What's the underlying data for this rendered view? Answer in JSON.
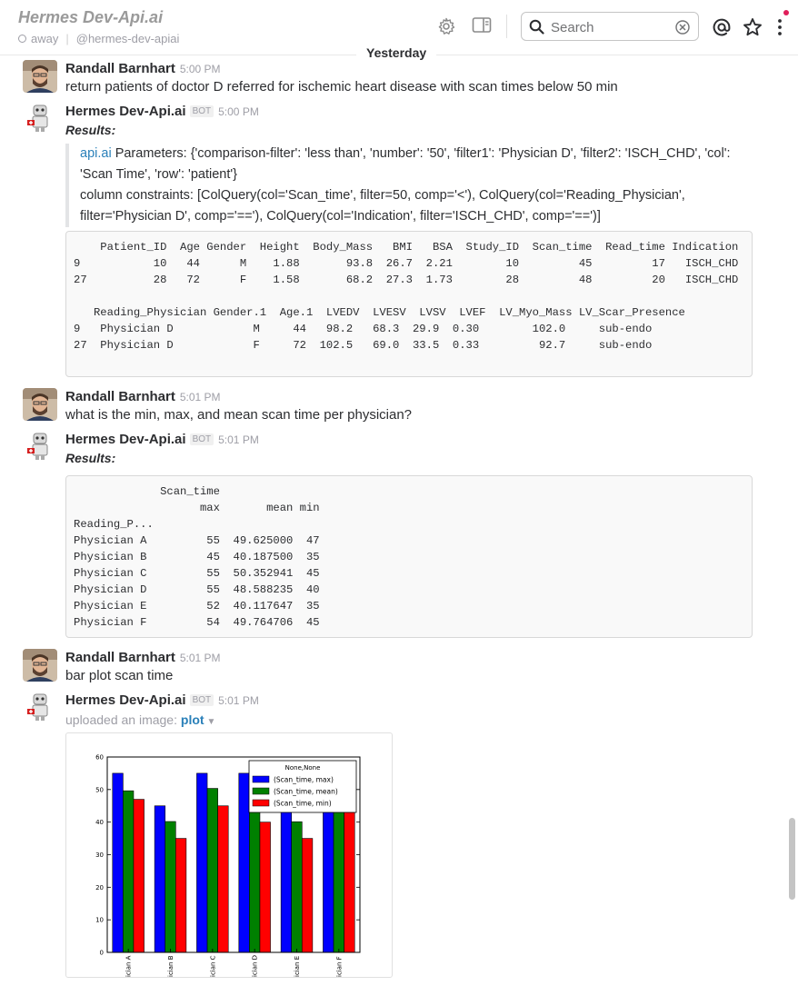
{
  "header": {
    "title": "Hermes Dev-Api.ai",
    "status": "away",
    "handle": "@hermes-dev-apiai",
    "search_placeholder": "Search",
    "notification_color": "#e01e5a"
  },
  "divider": {
    "label": "Yesterday"
  },
  "messages": [
    {
      "author": "Randall Barnhart",
      "time": "5:00 PM",
      "text": "return patients of doctor D referred for ischemic heart disease with scan times below 50 min"
    },
    {
      "author": "Hermes Dev-Api.ai",
      "badge": "BOT",
      "time": "5:00 PM",
      "results_label": "Results:",
      "quote_link": "api.ai",
      "quote_line1": " Parameters: {'comparison-filter': 'less than', 'number': '50', 'filter1': 'Physician D', 'filter2': 'ISCH_CHD', 'col':",
      "quote_line2": "'Scan Time', 'row': 'patient'}",
      "quote_line3": "column constraints: [ColQuery(col='Scan_time', filter=50, comp='<'), ColQuery(col='Reading_Physician',",
      "quote_line4": "filter='Physician D', comp='=='), ColQuery(col='Indication', filter='ISCH_CHD', comp='==')]",
      "code": "    Patient_ID  Age Gender  Height  Body_Mass   BMI   BSA  Study_ID  Scan_time  Read_time Indication  \\\n9           10   44      M    1.88       93.8  26.7  2.21        10         45         17   ISCH_CHD\n27          28   72      F    1.58       68.2  27.3  1.73        28         48         20   ISCH_CHD\n\n   Reading_Physician Gender.1  Age.1  LVEDV  LVESV  LVSV  LVEF  LV_Myo_Mass LV_Scar_Presence\n9   Physician D            M     44   98.2   68.3  29.9  0.30        102.0     sub-endo\n27  Physician D            F     72  102.5   69.0  33.5  0.33         92.7     sub-endo"
    },
    {
      "author": "Randall Barnhart",
      "time": "5:01 PM",
      "text": "what is the min, max, and mean scan time per physician?"
    },
    {
      "author": "Hermes Dev-Api.ai",
      "badge": "BOT",
      "time": "5:01 PM",
      "results_label": "Results:",
      "code": "             Scan_time\n                   max       mean min\nReading_P...\nPhysician A         55  49.625000  47\nPhysician B         45  40.187500  35\nPhysician C         55  50.352941  45\nPhysician D         55  48.588235  40\nPhysician E         52  40.117647  35\nPhysician F         54  49.764706  45"
    },
    {
      "author": "Randall Barnhart",
      "time": "5:01 PM",
      "text": "bar plot scan time"
    },
    {
      "author": "Hermes Dev-Api.ai",
      "badge": "BOT",
      "time": "5:01 PM",
      "uploaded_label": "uploaded an image:",
      "attachment_name": "plot"
    }
  ],
  "chart_data": {
    "type": "bar",
    "categories": [
      "Physician A",
      "Physician B",
      "Physician C",
      "Physician D",
      "Physician E",
      "Physician F"
    ],
    "category_labels_visible": [
      "ician A",
      "ician B",
      "ician C",
      "ician D",
      "ician E",
      "ician F"
    ],
    "series": [
      {
        "name": "(Scan_time, max)",
        "values": [
          55,
          45,
          55,
          55,
          52,
          54
        ],
        "color": "#0000ff"
      },
      {
        "name": "(Scan_time, mean)",
        "values": [
          49.625,
          40.1875,
          50.352941,
          48.588235,
          40.117647,
          49.764706
        ],
        "color": "#008000"
      },
      {
        "name": "(Scan_time, min)",
        "values": [
          47,
          35,
          45,
          40,
          35,
          45
        ],
        "color": "#ff0000"
      }
    ],
    "legend_title": "None,None",
    "legend_placement": "top-right",
    "ylim": [
      0,
      60
    ],
    "yticks": [
      0,
      10,
      20,
      30,
      40,
      50,
      60
    ],
    "grid": false
  }
}
